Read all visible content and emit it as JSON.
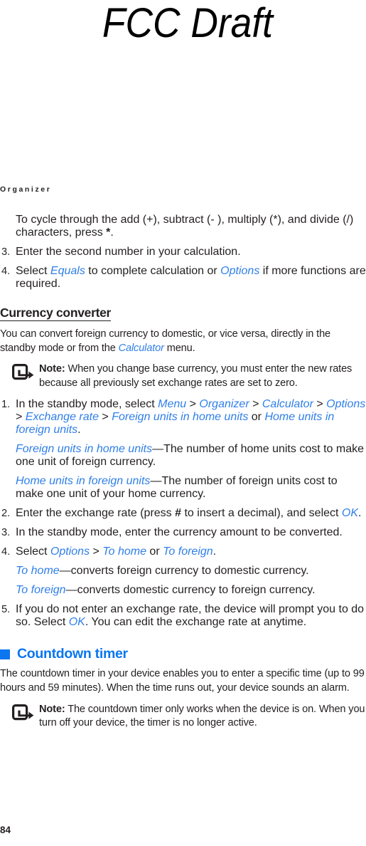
{
  "watermark": {
    "text": "FCC Draft"
  },
  "running_header": {
    "text": "Organizer"
  },
  "colors": {
    "link_blue": "#2f7fe8",
    "heading_blue": "#0b76f0",
    "body_text": "#231f20"
  },
  "icons": {
    "note": "note-callout-icon",
    "square_bullet": "blue-square-bullet-icon"
  },
  "content": {
    "intro_paragraph": {
      "line": "To cycle through the add (+), subtract (- ), multiply (*), and divide (/) characters, press ",
      "bold_tail": "*",
      "period": "."
    },
    "calc_steps": [
      {
        "number": "3.",
        "text": "Enter the second number in your calculation."
      },
      {
        "number": "4.",
        "prefix": "Select ",
        "ui1": "Equals",
        "mid": " to complete calculation or ",
        "ui2": "Options",
        "suffix": " if more functions are required."
      }
    ],
    "currency_section": {
      "heading": "Currency converter",
      "intro_prefix": "You can convert foreign currency to domestic, or vice versa, directly in the standby mode or from the ",
      "intro_ui": "Calculator",
      "intro_suffix": " menu.",
      "note": {
        "label": "Note:",
        "text": " When you change base currency, you must enter the new rates because all previously set exchange rates are set to zero."
      },
      "step1": {
        "number": "1.",
        "prefix": "In the standby mode, select ",
        "path": [
          "Menu",
          "Organizer",
          "Calculator",
          "Options",
          "Exchange rate",
          "Foreign units in home units"
        ],
        "separator": " > ",
        "or_word": " or ",
        "alt_path": "Home units in foreign units",
        "end": "."
      },
      "def1": {
        "term": "Foreign units in home units",
        "dash": "—",
        "text": "The number of home units cost to make one unit of foreign currency."
      },
      "def2": {
        "term": "Home units in foreign units",
        "dash": "—",
        "text": "The number of foreign units cost to make one unit of your home currency."
      },
      "step2": {
        "number": "2.",
        "prefix": "Enter the exchange rate (press ",
        "key": "#",
        "mid": " to insert a decimal), and select ",
        "ui": "OK",
        "suffix": "."
      },
      "step3": {
        "number": "3.",
        "text": "In the standby mode, enter the currency amount to be converted."
      },
      "step4": {
        "number": "4.",
        "prefix": "Select ",
        "ui1": "Options",
        "sep": " > ",
        "ui2": "To home",
        "or_word": " or ",
        "ui3": "To foreign",
        "suffix": "."
      },
      "def3": {
        "term": "To home",
        "dash": "—",
        "text": "converts foreign currency to domestic currency."
      },
      "def4": {
        "term": "To foreign",
        "dash": "—",
        "text": "converts domestic currency to foreign currency."
      },
      "step5": {
        "number": "5.",
        "prefix": "If you do not enter an exchange rate, the device will prompt you to do so. Select ",
        "ui": "OK",
        "suffix": ". You can edit the exchange rate at anytime."
      }
    },
    "countdown_section": {
      "heading": "Countdown timer",
      "paragraph": "The countdown timer in your device enables you to enter a specific time (up to 99 hours and 59 minutes). When the time runs out, your device sounds an alarm.",
      "note": {
        "label": "Note:",
        "text": " The countdown timer only works when the device is on. When you turn off your device, the timer is no longer active."
      }
    }
  },
  "footer": {
    "page_number": "84"
  }
}
